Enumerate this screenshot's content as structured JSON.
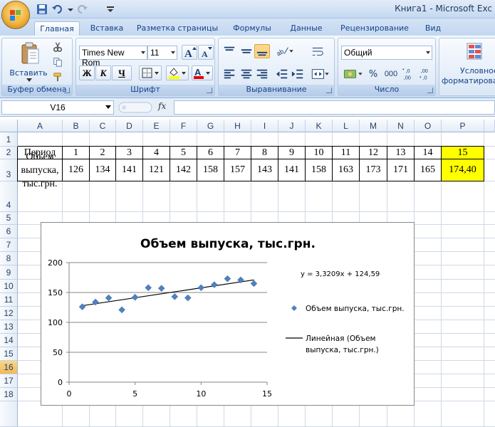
{
  "window": {
    "title": "Книга1 - Microsoft Exc"
  },
  "ribbon": {
    "tabs": [
      "Главная",
      "Вставка",
      "Разметка страницы",
      "Формулы",
      "Данные",
      "Рецензирование",
      "Вид"
    ],
    "active_tab": "Главная",
    "clipboard": {
      "label": "Буфер обмена",
      "paste_label": "Вставить"
    },
    "font": {
      "label": "Шрифт",
      "name": "Times New Rom",
      "size": "11",
      "bold": "Ж",
      "italic": "К",
      "underline": "Ч"
    },
    "alignment": {
      "label": "Выравнивание"
    },
    "number": {
      "label": "Число",
      "format": "Общий",
      "percent": "%",
      "thousands": "000",
      "inc_decimal": ",0\n,00",
      "dec_decimal": ",00\n,0"
    },
    "styles": {
      "conditional_formatting_line1": "Условное",
      "conditional_formatting_line2": "форматирова"
    }
  },
  "formula_bar": {
    "name_box": "V16",
    "fx": "fx",
    "value": ""
  },
  "sheet": {
    "columns": [
      "A",
      "B",
      "C",
      "D",
      "E",
      "F",
      "G",
      "H",
      "I",
      "J",
      "K",
      "L",
      "M",
      "N",
      "O",
      "P"
    ],
    "rows": [
      "1",
      "2",
      "3",
      "4",
      "5",
      "6",
      "7",
      "8",
      "9",
      "10",
      "11",
      "12",
      "13",
      "14",
      "15",
      "16",
      "17",
      "18"
    ],
    "selected_row": "16",
    "row2_label": "Период",
    "row3_label_lines": [
      "Объем",
      "выпуска,",
      "тыс.грн."
    ],
    "periods": [
      "1",
      "2",
      "3",
      "4",
      "5",
      "6",
      "7",
      "8",
      "9",
      "10",
      "11",
      "12",
      "13",
      "14",
      "15"
    ],
    "volumes": [
      "126",
      "134",
      "141",
      "121",
      "142",
      "158",
      "157",
      "143",
      "141",
      "158",
      "163",
      "173",
      "171",
      "165",
      "174,40"
    ],
    "highlight_color": "#ffff00"
  },
  "chart_data": {
    "type": "scatter",
    "title": "Объем выпуска, тыс.грн.",
    "xlim": [
      0,
      15
    ],
    "ylim": [
      0,
      200
    ],
    "xticks": [
      "0",
      "5",
      "10",
      "15"
    ],
    "yticks": [
      "0",
      "50",
      "100",
      "150",
      "200"
    ],
    "grid": "horizontal",
    "legend_position": "right",
    "series": [
      {
        "name": "Объем выпуска, тыс.грн.",
        "marker": "diamond",
        "color": "#4f81bd",
        "x": [
          1,
          2,
          3,
          4,
          5,
          6,
          7,
          8,
          9,
          10,
          11,
          12,
          13,
          14
        ],
        "y": [
          126,
          134,
          141,
          121,
          142,
          158,
          157,
          143,
          141,
          158,
          163,
          173,
          171,
          165
        ]
      }
    ],
    "trendline": {
      "name": "Линейная (Объем выпуска, тыс.грн.)",
      "name_lines": [
        "Линейная (Объем",
        "выпуска, тыс.грн.)"
      ],
      "slope": 3.3209,
      "intercept": 124.59,
      "equation": "y = 3,3209x + 124,59",
      "color": "#000000"
    }
  }
}
